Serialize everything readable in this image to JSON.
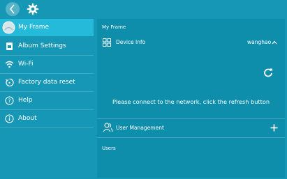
{
  "sidebar": {
    "items": [
      {
        "label": "My Frame",
        "icon": "frame-avatar-icon"
      },
      {
        "label": "Album Settings",
        "icon": "album-icon"
      },
      {
        "label": "Wi-Fi",
        "icon": "wifi-icon"
      },
      {
        "label": "Factory data reset",
        "icon": "reset-icon"
      },
      {
        "label": "Help",
        "icon": "help-icon"
      },
      {
        "label": "About",
        "icon": "info-icon"
      }
    ]
  },
  "main": {
    "section_title": "My Frame",
    "device_info": {
      "label": "Device Info",
      "user": "wanghao"
    },
    "message": "Please connect to the network, click the refresh button",
    "user_management": {
      "label": "User Management"
    },
    "users": {
      "label": "Users"
    }
  },
  "colors": {
    "background": "#1597b5",
    "active": "#25b9da",
    "panel": "#0f8eab"
  }
}
